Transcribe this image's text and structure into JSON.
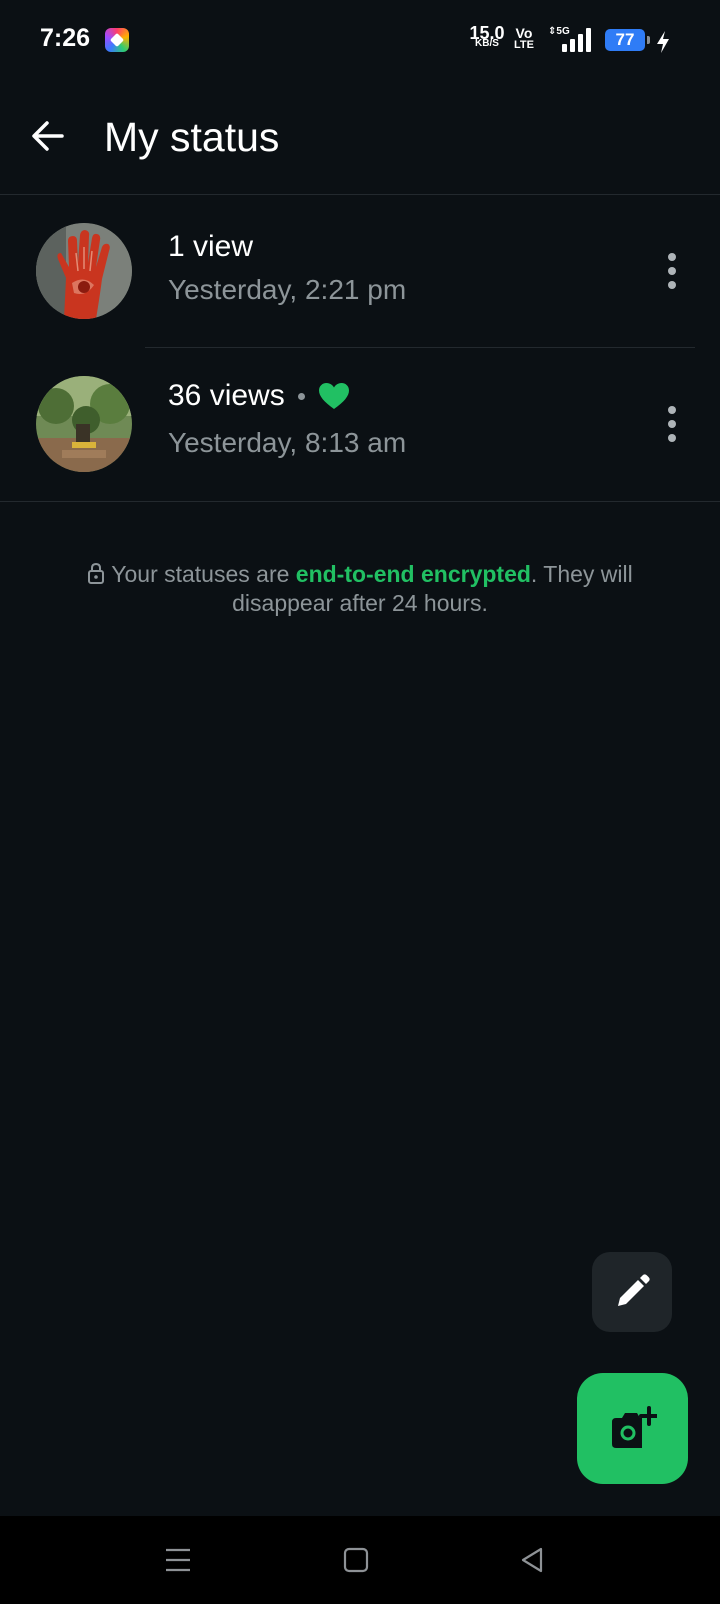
{
  "status_bar": {
    "time": "7:26",
    "net_speed_value": "15.0",
    "net_speed_unit": "KB/S",
    "volte_top": "Vo",
    "volte_bottom": "LTE",
    "signal_label": "5G",
    "battery_percent": "77",
    "charging": true
  },
  "header": {
    "title": "My status",
    "back_icon": "arrow-left-icon"
  },
  "statuses": [
    {
      "views": "1 view",
      "time": "Yesterday, 2:21 pm",
      "liked": false,
      "thumbnail": "hand-with-red-henna"
    },
    {
      "views": "36 views",
      "time": "Yesterday, 8:13 am",
      "liked": true,
      "thumbnail": "outdoor-shrine-with-trees"
    }
  ],
  "encryption_note": {
    "prefix": "Your statuses are ",
    "link": "end-to-end encrypted",
    "suffix": ". They will disappear after 24 hours."
  },
  "actions": {
    "text_status_icon": "pencil-icon",
    "camera_status_icon": "camera-plus-icon"
  },
  "nav": {
    "recents_icon": "menu-lines-icon",
    "home_icon": "square-icon",
    "back_icon": "triangle-back-icon"
  },
  "colors": {
    "background": "#0b1014",
    "accent_green": "#21c063",
    "secondary_text": "#8d9599",
    "battery_blue": "#2f7cf6"
  }
}
